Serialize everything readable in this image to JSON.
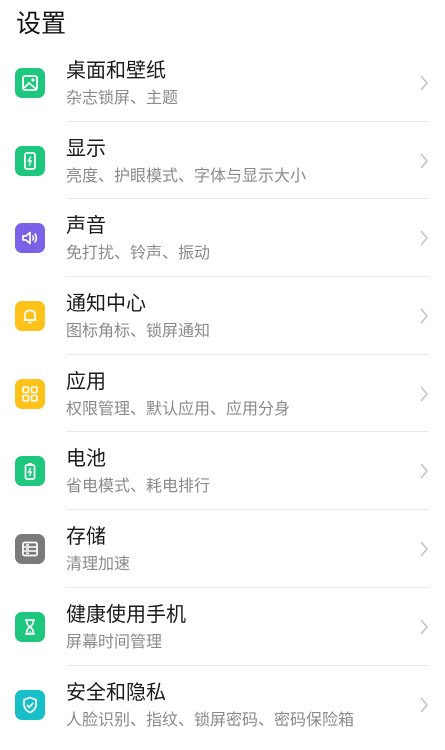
{
  "header": {
    "title": "设置"
  },
  "colors": {
    "green": "#1dc77e",
    "purple": "#7b61e8",
    "yellow": "#ffc21a",
    "gray": "#7a7a7a",
    "teal": "#17c0c8"
  },
  "items": [
    {
      "title": "桌面和壁纸",
      "subtitle": "杂志锁屏、主题",
      "icon": "wallpaper-icon",
      "color": "#1dc77e"
    },
    {
      "title": "显示",
      "subtitle": "亮度、护眼模式、字体与显示大小",
      "icon": "display-icon",
      "color": "#1dc77e"
    },
    {
      "title": "声音",
      "subtitle": "免打扰、铃声、振动",
      "icon": "speaker-icon",
      "color": "#7b61e8"
    },
    {
      "title": "通知中心",
      "subtitle": "图标角标、锁屏通知",
      "icon": "bell-icon",
      "color": "#ffc21a"
    },
    {
      "title": "应用",
      "subtitle": "权限管理、默认应用、应用分身",
      "icon": "apps-grid-icon",
      "color": "#ffc21a"
    },
    {
      "title": "电池",
      "subtitle": "省电模式、耗电排行",
      "icon": "battery-icon",
      "color": "#1dc77e"
    },
    {
      "title": "存储",
      "subtitle": "清理加速",
      "icon": "storage-icon",
      "color": "#7a7a7a"
    },
    {
      "title": "健康使用手机",
      "subtitle": "屏幕时间管理",
      "icon": "hourglass-icon",
      "color": "#1dc77e"
    },
    {
      "title": "安全和隐私",
      "subtitle": "人脸识别、指纹、锁屏密码、密码保险箱",
      "icon": "shield-check-icon",
      "color": "#17c0c8"
    }
  ]
}
